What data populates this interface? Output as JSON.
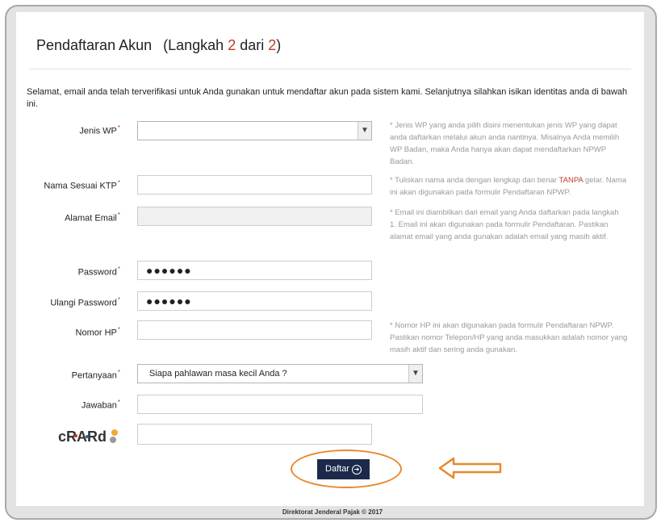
{
  "header": {
    "title": "Pendaftaran Akun",
    "step_prefix": "(Langkah",
    "step_current": "2",
    "step_mid": "dari",
    "step_total": "2",
    "step_suffix": ")"
  },
  "intro": "Selamat, email anda telah terverifikasi untuk Anda gunakan untuk mendaftar akun pada sistem kami. Selanjutnya silahkan isikan identitas anda di bawah ini.",
  "form": {
    "required_mark": "*",
    "jenis_wp": {
      "label": "Jenis WP",
      "value": "",
      "hint": "Jenis WP yang anda pilih disini menentukan jenis WP yang dapat anda daftarkan melalui akun anda nantinya. Misalnya Anda memilih WP Badan, maka Anda hanya akan dapat mendaftarkan NPWP Badan."
    },
    "nama": {
      "label": "Nama Sesuai KTP",
      "value": "",
      "hint_before": "Tuliskan nama anda dengan lengkap dan benar",
      "hint_emphasis": "TANPA",
      "hint_after": "gelar. Nama ini akan digunakan pada formulir Pendaftaran NPWP."
    },
    "email": {
      "label": "Alamat Email",
      "value": "",
      "hint": "Email ini diambilkan dari email yang Anda daftarkan pada langkah 1. Email ini akan digunakan pada formulir Pendaftaran. Pastikan alamat email yang anda gunakan adalah email yang masih aktif."
    },
    "password": {
      "label": "Password",
      "value": "●●●●●●"
    },
    "ulangi_password": {
      "label": "Ulangi Password",
      "value": "●●●●●●"
    },
    "nomor_hp": {
      "label": "Nomor HP",
      "value": "",
      "hint": "Nomor HP ini akan digunakan pada formulir Pendaftaran NPWP. Pastikan nomor Telepon/HP yang anda masukkan adalah nomor yang masih aktif dan sering anda gunakan."
    },
    "pertanyaan": {
      "label": "Pertanyaan",
      "value": "Siapa pahlawan masa kecil Anda ?"
    },
    "jawaban": {
      "label": "Jawaban",
      "value": ""
    },
    "captcha": {
      "text": "cRARd",
      "value": ""
    },
    "submit_label": "Daftar"
  },
  "footer": "Direktorat Jenderal Pajak © 2017",
  "colors": {
    "accent_red": "#c0392b",
    "button_navy": "#1b2a4b",
    "annotation_orange": "#e8882f",
    "hint_gray": "#9a9a9a"
  },
  "icons": {
    "select_arrow": "chevron-down-icon",
    "submit_arrow": "arrow-right-circle-icon",
    "annotation_arrow": "left-arrow-icon",
    "annotation_ellipse": "highlight-ellipse"
  }
}
